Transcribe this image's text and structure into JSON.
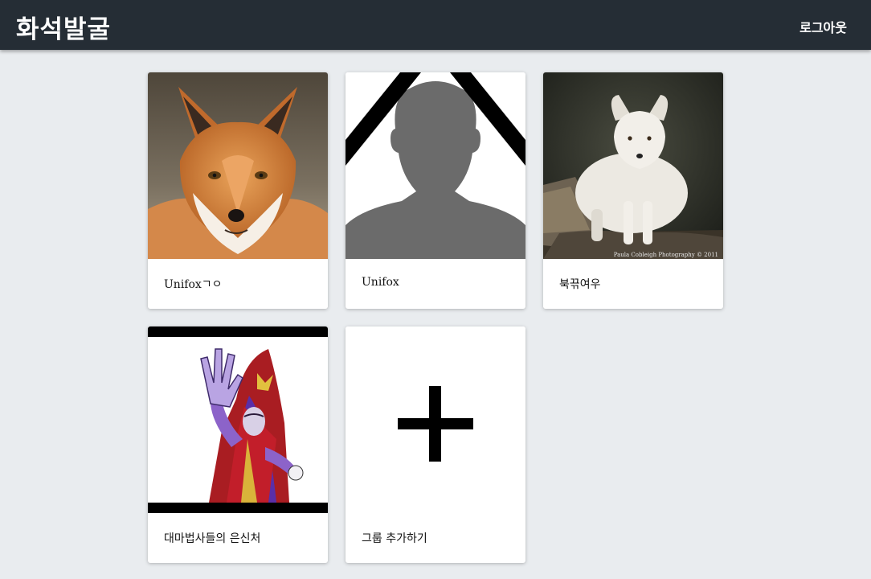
{
  "header": {
    "brand": "화석발굴",
    "logout_label": "로그아웃"
  },
  "groups": [
    {
      "label": "Unifoxㄱㅇ",
      "image": "red-fox-photo"
    },
    {
      "label": "Unifox",
      "image": "default-profile-silhouette-with-mourning-ribbon"
    },
    {
      "label": "북끆여우",
      "image": "arctic-fox-photo",
      "watermark": "Paula Cobleigh Photography © 2011"
    },
    {
      "label": "대마법사들의 은신처",
      "image": "cartoon-sorceress-illustration"
    }
  ],
  "add_group": {
    "label": "그룹 추가하기",
    "icon": "plus-icon"
  },
  "colors": {
    "header_bg": "#252d35",
    "page_bg": "#e9ecef",
    "card_bg": "#ffffff"
  }
}
